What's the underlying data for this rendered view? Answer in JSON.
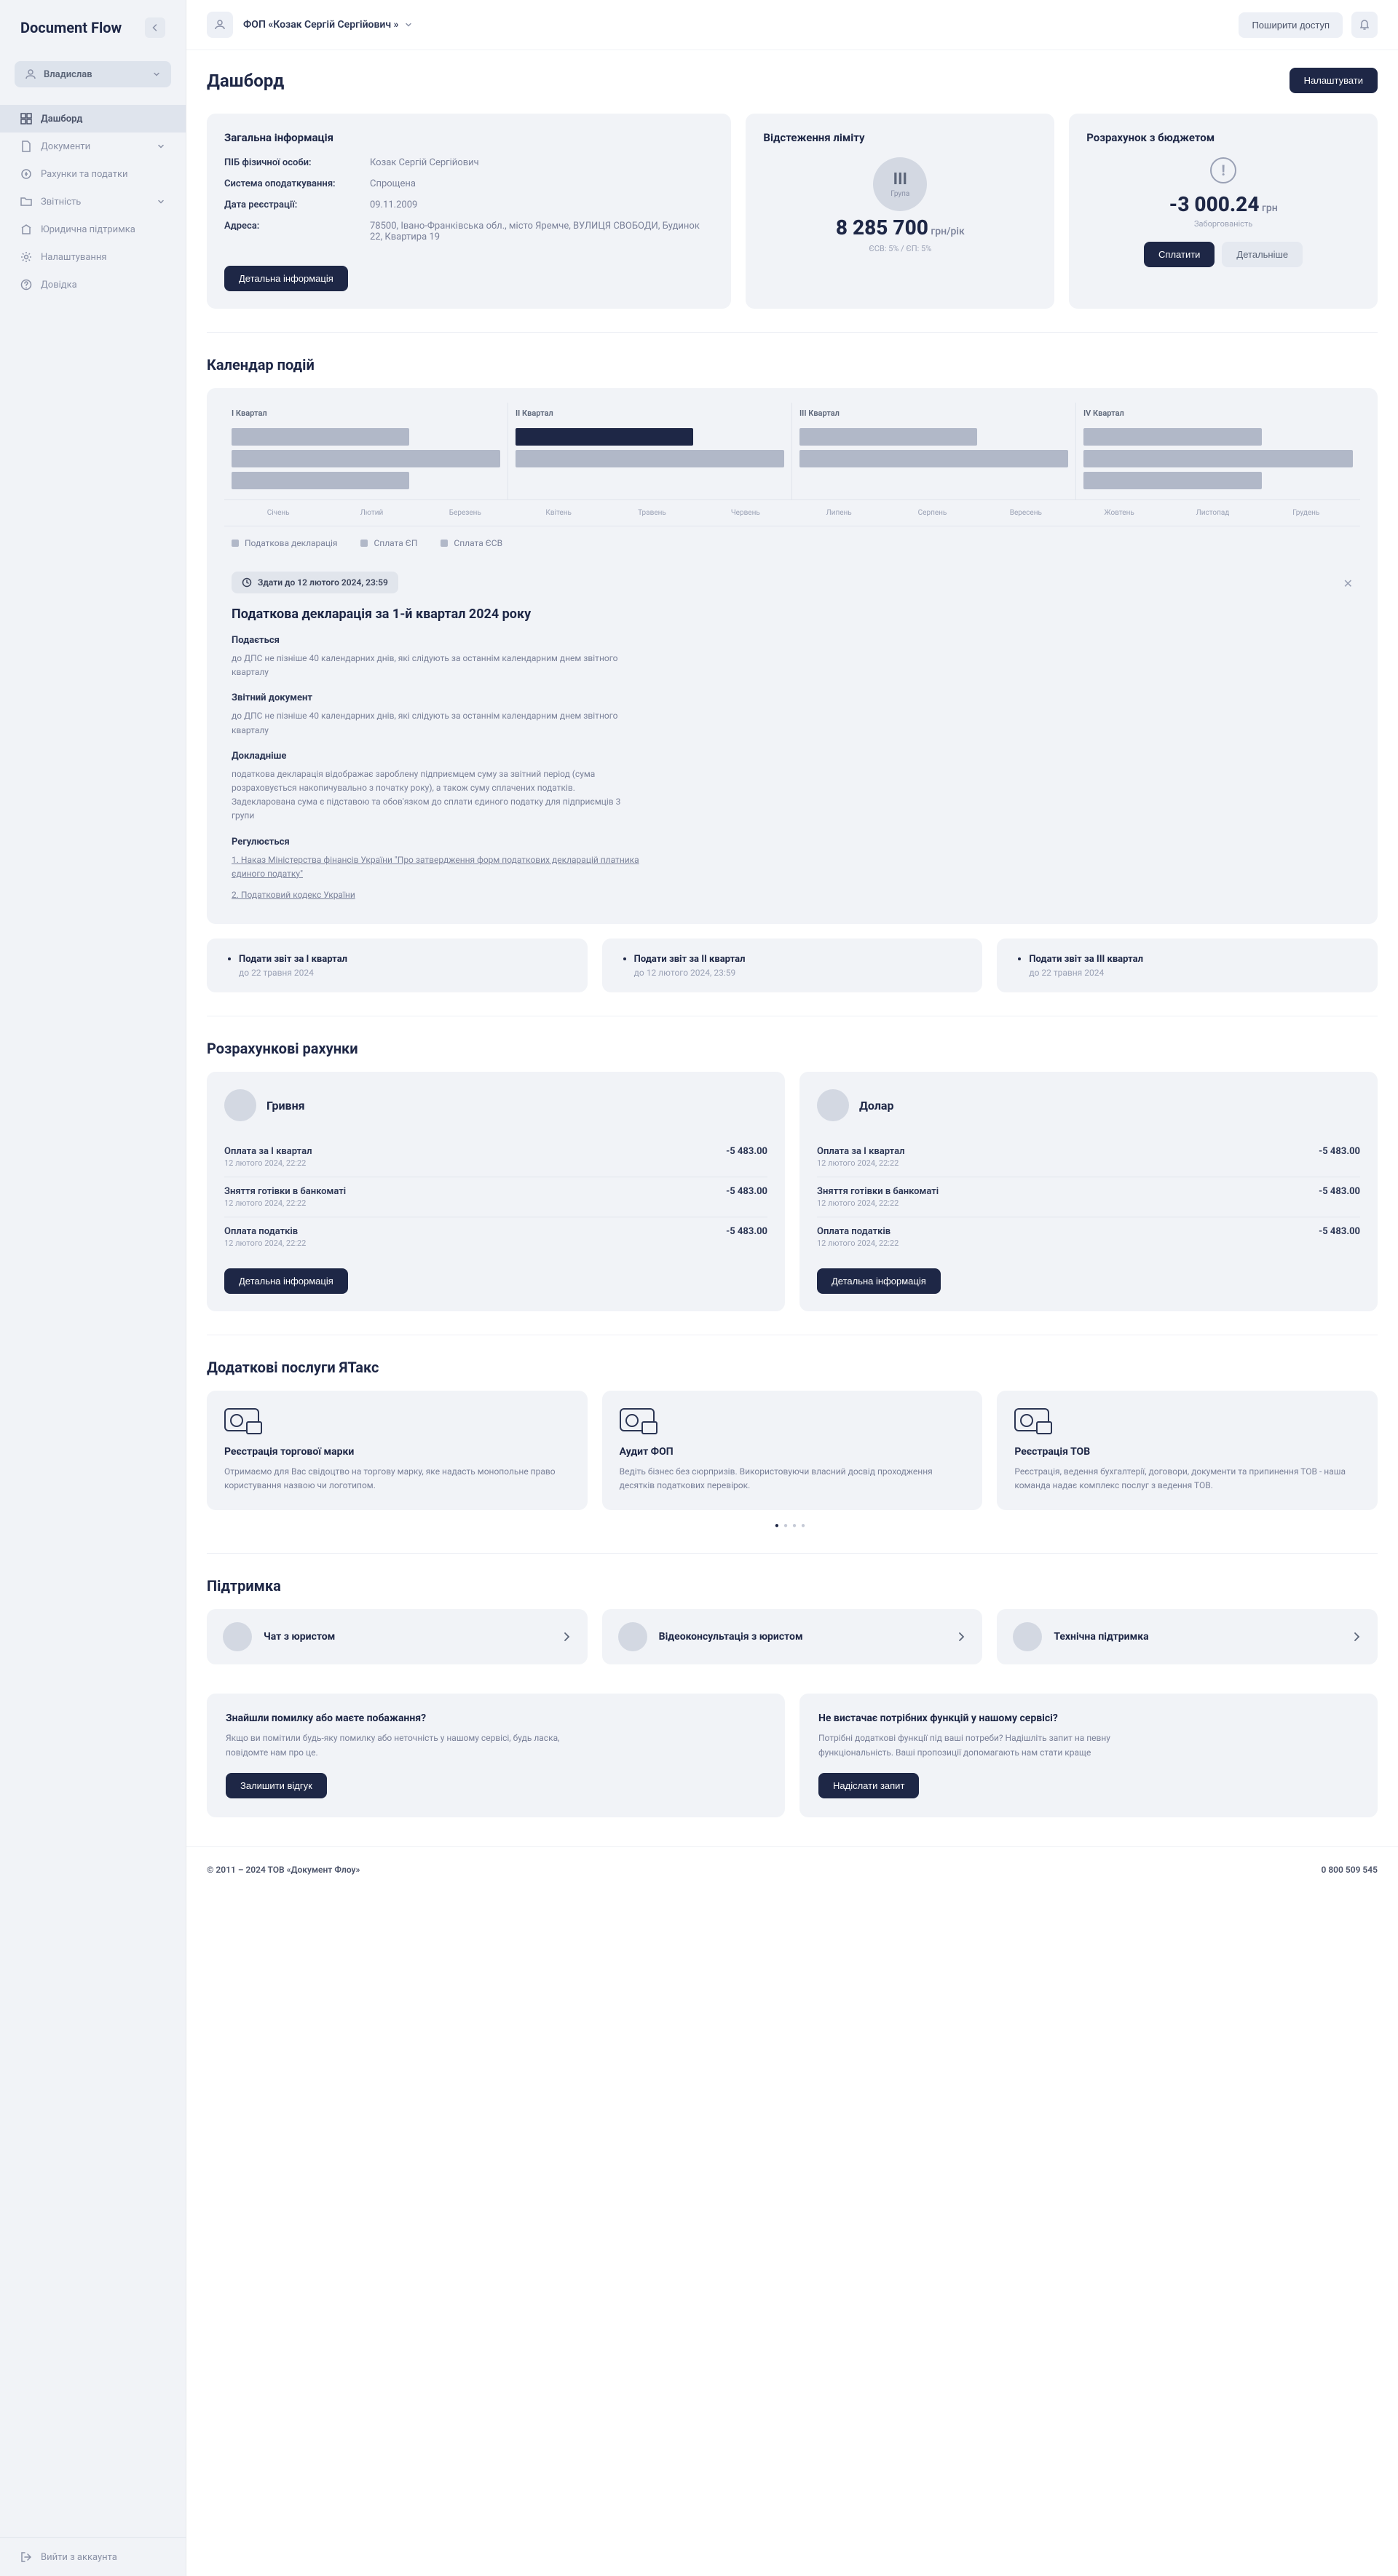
{
  "logo": "Document Flow",
  "user": {
    "name": "Владислав"
  },
  "nav": [
    {
      "label": "Дашборд",
      "active": true
    },
    {
      "label": "Документи",
      "expand": true
    },
    {
      "label": "Рахунки та податки"
    },
    {
      "label": "Звітність",
      "expand": true
    },
    {
      "label": "Юридична підтримка"
    },
    {
      "label": "Налаштування"
    },
    {
      "label": "Довідка"
    }
  ],
  "logout": "Вийти з аккаунта",
  "topbar": {
    "company": "ФОП «Козак Сергій Сергійович »",
    "share": "Поширити доступ"
  },
  "page": {
    "title": "Дашборд",
    "settings": "Налаштувати"
  },
  "general": {
    "title": "Загальна інформація",
    "rows": [
      {
        "label": "ПІБ фізичної особи:",
        "value": "Козак Сергій Сергійович"
      },
      {
        "label": "Система оподаткування:",
        "value": "Спрощена"
      },
      {
        "label": "Дата реєстрації:",
        "value": "09.11.2009"
      },
      {
        "label": "Адреса:",
        "value": "78500, Івано-Франківська обл., місто Яремче, ВУЛИЦЯ СВОБОДИ, Будинок 22, Квартира 19"
      }
    ],
    "button": "Детальна інформація"
  },
  "limit": {
    "title": "Відстеження ліміту",
    "group_num": "III",
    "group_label": "Група",
    "value": "8 285 700",
    "unit": "грн/рік",
    "note": "ЄСВ: 5%   /   ЄП: 5%"
  },
  "budget": {
    "title": "Розрахунок з бюджетом",
    "value": "-3 000.24",
    "unit": "грн",
    "note": "Заборгованість",
    "pay": "Сплатити",
    "more": "Детальніше"
  },
  "calendar": {
    "title": "Календар подій",
    "quarters": [
      "I Квартал",
      "II Квартал",
      "III Квартал",
      "IV Квартал"
    ],
    "months": [
      "Січень",
      "Лютий",
      "Березень",
      "Квітень",
      "Травень",
      "Червень",
      "Липень",
      "Серпень",
      "Вересень",
      "Жовтень",
      "Листопад",
      "Грудень"
    ],
    "legend": [
      "Податкова декларація",
      "Сплата ЄП",
      "Сплата ЄСВ"
    ],
    "deadline": "Здати до 12 лютого 2024, 23:59"
  },
  "declaration": {
    "title": "Податкова декларація за 1-й квартал 2024 року",
    "sections": [
      {
        "h": "Подається",
        "p": "до ДПС не пізніше 40 календарних днів, які слідують за останнім календарним днем звітного кварталу"
      },
      {
        "h": "Звітний документ",
        "p": "до ДПС не пізніше 40 календарних днів, які слідують за останнім календарним днем звітного кварталу"
      },
      {
        "h": "Докладніше",
        "p": "податкова декларація відображає зароблену підприємцем суму за звітний період (сума розраховується накопичувально з початку року), а також суму сплачених податків. Задекларована сума є підставою та обов'язком до сплати єдиного податку для підприємців 3 групи"
      },
      {
        "h": "Регулюється",
        "links": [
          "1. Наказ Міністерства фінансів України \"Про затвердження форм податкових декларацій платника єдиного податку\"",
          "2. Податковий кодекс України"
        ]
      }
    ]
  },
  "reports": [
    {
      "title": "Подати звіт за I квартал",
      "date": "до 22 травня 2024"
    },
    {
      "title": "Подати звіт за II квартал",
      "date": "до 12 лютого 2024, 23:59"
    },
    {
      "title": "Подати звіт за III квартал",
      "date": "до 22 травня 2024"
    }
  ],
  "accounts": {
    "title": "Розрахункові рахунки",
    "list": [
      {
        "name": "Гривня",
        "tx": [
          {
            "title": "Оплата за I квартал",
            "date": "12 лютого 2024, 22:22",
            "amount": "-5 483.00"
          },
          {
            "title": "Зняття готівки в банкоматі",
            "date": "12 лютого 2024, 22:22",
            "amount": "-5 483.00"
          },
          {
            "title": "Оплата податків",
            "date": "12 лютого 2024, 22:22",
            "amount": "-5 483.00"
          }
        ],
        "button": "Детальна інформація"
      },
      {
        "name": "Долар",
        "tx": [
          {
            "title": "Оплата за I квартал",
            "date": "12 лютого 2024, 22:22",
            "amount": "-5 483.00"
          },
          {
            "title": "Зняття готівки в банкоматі",
            "date": "12 лютого 2024, 22:22",
            "amount": "-5 483.00"
          },
          {
            "title": "Оплата податків",
            "date": "12 лютого 2024, 22:22",
            "amount": "-5 483.00"
          }
        ],
        "button": "Детальна інформація"
      }
    ]
  },
  "services": {
    "title": "Додаткові послуги ЯТакс",
    "list": [
      {
        "title": "Реєстрація торгової марки",
        "desc": "Отримаємо для Вас свідоцтво на торгову марку, яке надасть монопольне право користування назвою чи логотипом."
      },
      {
        "title": "Аудит ФОП",
        "desc": "Ведіть бізнес без сюрпризів. Використовуючи власний досвід проходження десятків податкових перевірок."
      },
      {
        "title": "Реєстрація ТОВ",
        "desc": "Реєстрація, ведення бухгалтерії, договори, документи та припинення ТОВ - наша команда надає комплекс послуг з ведення ТОВ."
      }
    ]
  },
  "support": {
    "title": "Підтримка",
    "list": [
      {
        "title": "Чат з юристом"
      },
      {
        "title": "Відеоконсультація з юристом"
      },
      {
        "title": "Технічна підтримка"
      }
    ]
  },
  "feedback": [
    {
      "title": "Знайшли помилку або маєте побажання?",
      "desc": "Якщо ви помітили будь-яку помилку або неточність у нашому сервісі, будь ласка, повідомте нам про це.",
      "button": "Залишити відгук"
    },
    {
      "title": "Не вистачає потрібних функцій у нашому сервісі?",
      "desc": "Потрібні додаткові функції під ваші потреби? Надішліть запит на певну функціональність. Ваші пропозиції допомагають нам стати краще",
      "button": "Надіслати запит"
    }
  ],
  "footer": {
    "copyright": "© 2011 – 2024 ТОВ «Документ Флоу»",
    "phone": "0 800 509 545"
  }
}
